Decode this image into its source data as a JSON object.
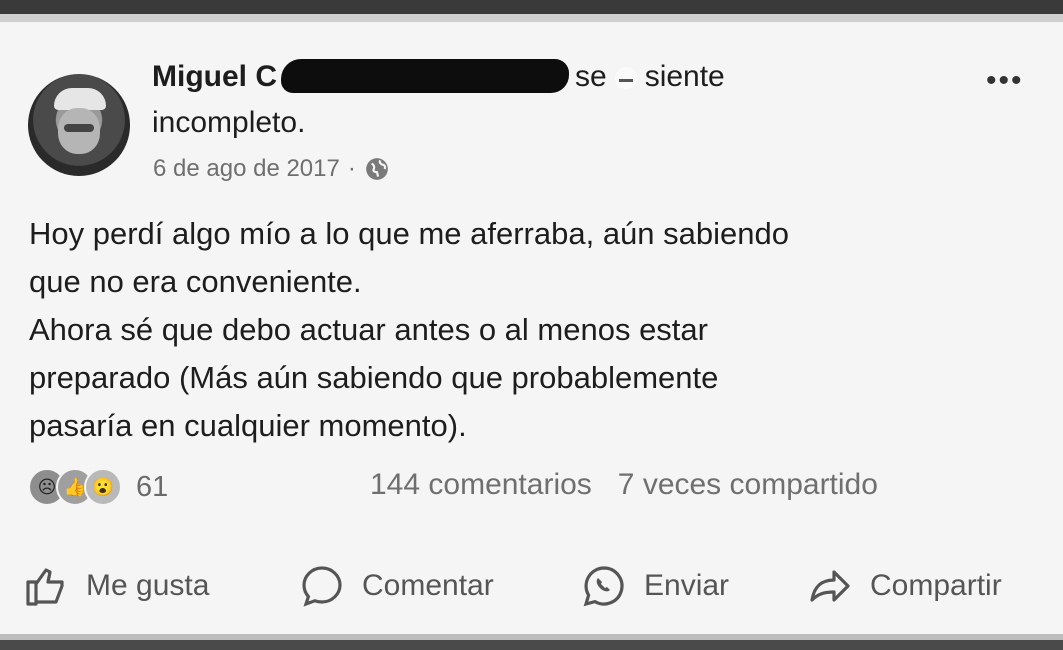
{
  "post": {
    "author": "Miguel C",
    "action_before": "se",
    "action_after": "siente",
    "feeling_line2": "incompleto.",
    "date": "6 de ago de 2017",
    "meta_separator": "·",
    "privacy_icon": "globe-icon",
    "more_icon": "more-options-icon",
    "body": [
      "Hoy perdí algo mío a lo que me aferraba, aún sabiendo",
      "que no era conveniente.",
      "Ahora sé que debo actuar antes o al menos estar",
      "preparado (Más aún sabiendo que probablemente",
      "pasaría en cualquier momento)."
    ]
  },
  "engagement": {
    "reaction_icons": [
      "sad-reaction-icon",
      "like-reaction-icon",
      "wow-reaction-icon"
    ],
    "reaction_count": "61",
    "comments": "144 comentarios",
    "shares": "7 veces compartido"
  },
  "actions": {
    "like": "Me gusta",
    "comment": "Comentar",
    "send": "Enviar",
    "share": "Compartir"
  }
}
